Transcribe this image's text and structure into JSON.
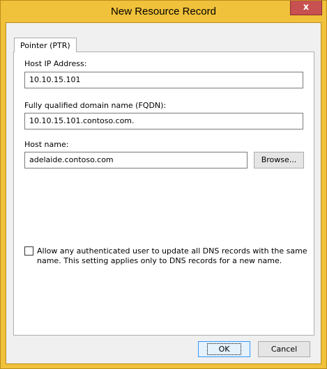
{
  "window": {
    "title": "New Resource Record",
    "close_glyph": "x"
  },
  "tab": {
    "label": "Pointer (PTR)"
  },
  "host_ip": {
    "label": "Host IP Address:",
    "value": "10.10.15.101"
  },
  "fqdn": {
    "label": "Fully qualified domain name (FQDN):",
    "value": "10.10.15.101.contoso.com."
  },
  "host_name": {
    "label": "Host name:",
    "value": "adelaide.contoso.com"
  },
  "browse_button": {
    "label": "Browse..."
  },
  "allow_update": {
    "checked": false,
    "label": "Allow any authenticated user to update all DNS records with the same name. This setting applies only to DNS records for a new name."
  },
  "footer": {
    "ok_label": "OK",
    "cancel_label": "Cancel"
  },
  "colors": {
    "frame": "#f0c13a",
    "close": "#c75050",
    "focus_border": "#3399ff"
  }
}
